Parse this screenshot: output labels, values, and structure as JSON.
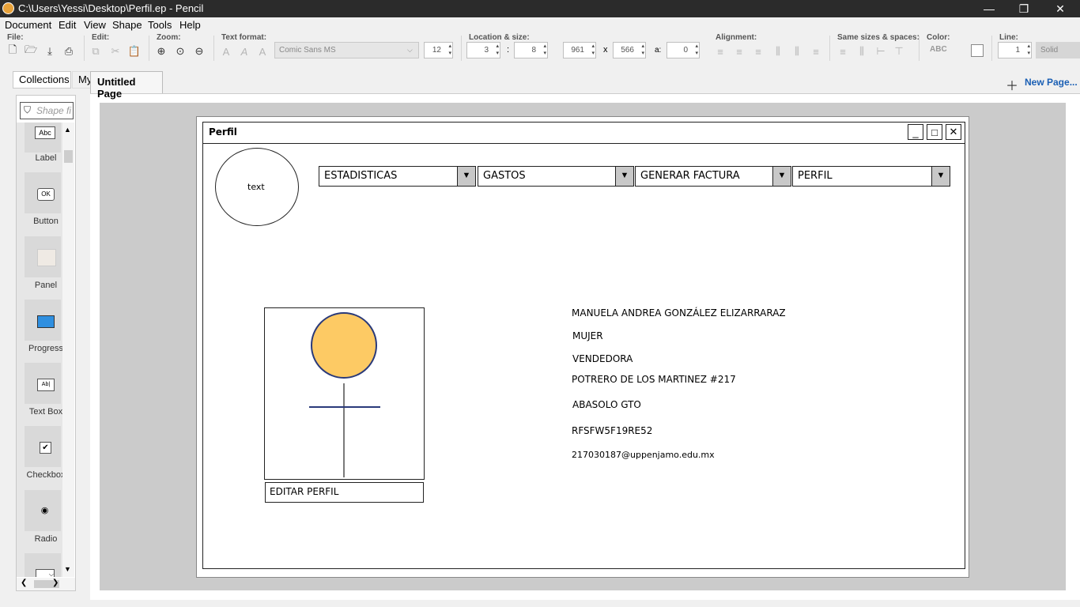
{
  "window": {
    "title": "C:\\Users\\Yessi\\Desktop\\Perfil.ep - Pencil",
    "minimize": "—",
    "restore": "❐",
    "close": "✕"
  },
  "menu": [
    "Document",
    "Edit",
    "View",
    "Shape",
    "Tools",
    "Help"
  ],
  "toolbar": {
    "file_label": "File:",
    "edit_label": "Edit:",
    "zoom_label": "Zoom:",
    "text_format_label": "Text format:",
    "font_name": "Comic Sans MS",
    "font_size": "12",
    "location_label": "Location & size:",
    "loc_x": "3",
    "loc_sep": ":",
    "loc_y": "8",
    "width": "961",
    "size_sep": "x",
    "height": "566",
    "angle_label": "a:",
    "angle": "0",
    "alignment_label": "Alignment:",
    "same_sizes_label": "Same sizes & spaces:",
    "color_label": "Color:",
    "color_abc": "ABC",
    "line_label": "Line:",
    "line_width": "1",
    "line_style": "Solid"
  },
  "left_panel": {
    "tab_collections": "Collections",
    "tab_my_stuff": "My Stuff",
    "filter_placeholder": "Shape fi",
    "shapes": [
      {
        "label": "Label",
        "glyph": "Abc"
      },
      {
        "label": "Button",
        "glyph": "OK"
      },
      {
        "label": "Panel",
        "glyph": ""
      },
      {
        "label": "Progress",
        "glyph": ""
      },
      {
        "label": "Text Box",
        "glyph": "Ab|"
      },
      {
        "label": "Checkbox",
        "glyph": "✔"
      },
      {
        "label": "Radio",
        "glyph": "◉"
      }
    ]
  },
  "page_tab": {
    "title": "Untitled Page",
    "new_page": "New Page..."
  },
  "mockup": {
    "window_title": "Perfil",
    "avatar_text": "text",
    "nav": [
      "ESTADISTICAS",
      "GASTOS",
      "GENERAR FACTURA",
      "PERFIL"
    ],
    "edit_button": "EDITAR PERFIL",
    "info": [
      "MANUELA ANDREA GONZÁLEZ ELIZARRARAZ",
      "MUJER",
      "VENDEDORA",
      "POTRERO DE LOS MARTINEZ #217",
      "ABASOLO GTO",
      "RFSFW5F19RE52",
      "217030187@uppenjamo.edu.mx"
    ],
    "figure_head_color": "#fdca64",
    "figure_stroke_color": "#2a3a7a"
  }
}
